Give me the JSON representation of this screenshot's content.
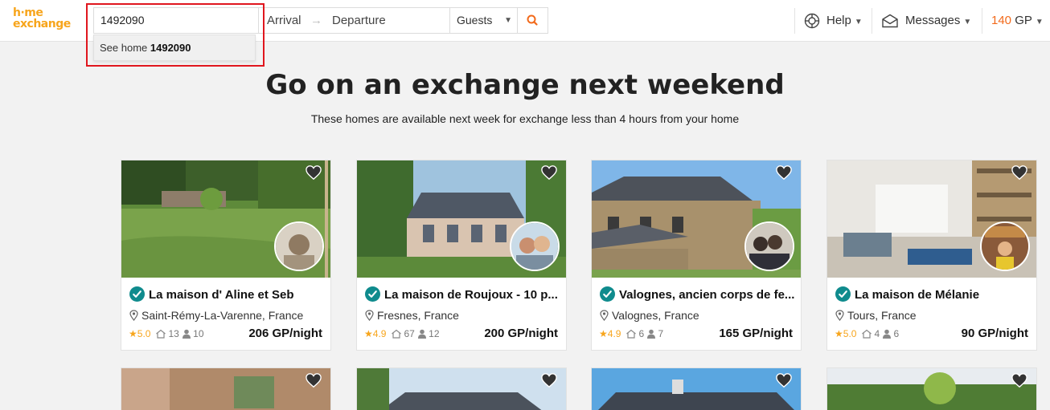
{
  "header": {
    "logo_line1": "h·me",
    "logo_line2": "exchange",
    "search_value": "1492090",
    "suggestion_prefix": "See home ",
    "suggestion_id": "1492090",
    "arrival": "Arrival",
    "arrow": "→",
    "departure": "Departure",
    "guests": "Guests",
    "help": "Help",
    "messages": "Messages",
    "gp_count": "140",
    "gp_unit": "GP"
  },
  "hero": {
    "title": "Go on an exchange next weekend",
    "subtitle": "These homes are available next week for exchange less than 4 hours from your home"
  },
  "colors": {
    "brand": "#f7a51c",
    "accent": "#f26a1b",
    "verified": "#0f8b8d",
    "highlight": "#e0161e"
  },
  "cards": [
    {
      "title": "La maison d' Aline et Seb",
      "location": "Saint-Rémy-La-Varenne, France",
      "rating": "5.0",
      "bedrooms": "13",
      "guests": "10",
      "price": "206 GP/night"
    },
    {
      "title": "La maison de Roujoux - 10 p...",
      "location": "Fresnes, France",
      "rating": "4.9",
      "bedrooms": "67",
      "guests": "12",
      "price": "200 GP/night"
    },
    {
      "title": "Valognes, ancien corps de fe...",
      "location": "Valognes, France",
      "rating": "4.9",
      "bedrooms": "6",
      "guests": "7",
      "price": "165 GP/night"
    },
    {
      "title": "La maison de Mélanie",
      "location": "Tours, France",
      "rating": "5.0",
      "bedrooms": "4",
      "guests": "6",
      "price": "90 GP/night"
    }
  ]
}
